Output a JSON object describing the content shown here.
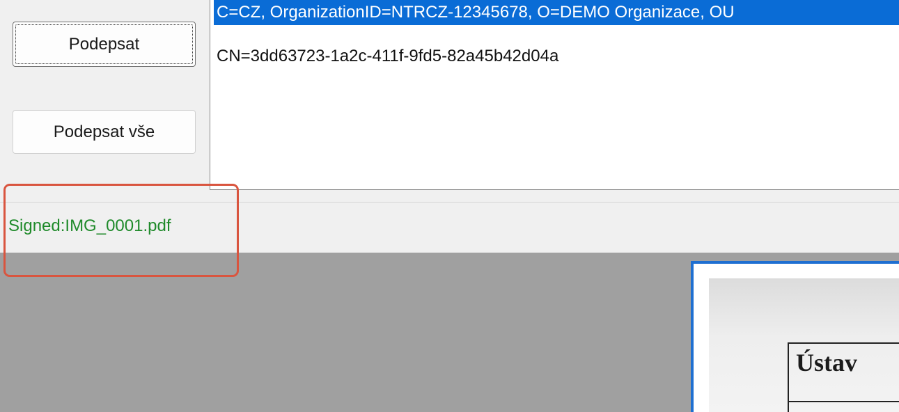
{
  "toolbar": {
    "sign_label": "Podepsat",
    "sign_all_label": "Podepsat vše"
  },
  "certificates": {
    "items": [
      {
        "label": "C=CZ, OrganizationID=NTRCZ-12345678, O=DEMO Organizace, OU",
        "selected": true
      },
      {
        "label": "CN=3dd63723-1a2c-411f-9fd5-82a45b42d04a",
        "selected": false
      }
    ]
  },
  "status": {
    "text": "Signed:IMG_0001.pdf",
    "color": "#1f8a2a"
  },
  "preview": {
    "heading": "Ústav"
  },
  "colors": {
    "selection": "#0a6cd6",
    "highlight": "#d9553f",
    "page_border": "#1e6fd1",
    "preview_bg": "#a0a0a0"
  },
  "icons": []
}
